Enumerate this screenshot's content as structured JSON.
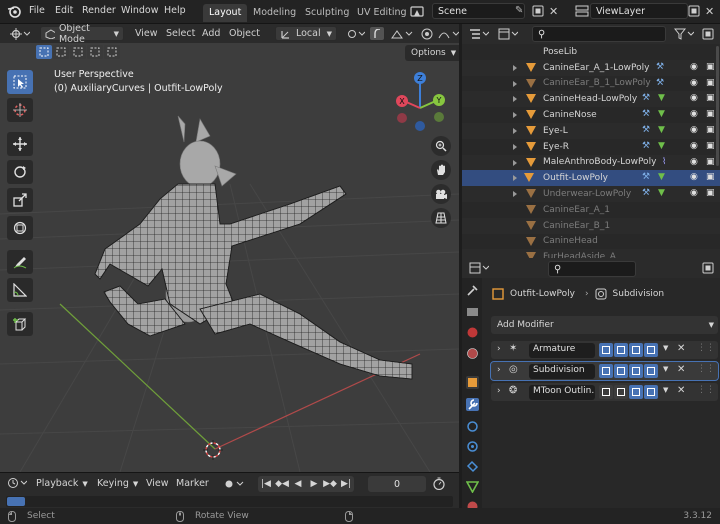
{
  "menubar": {
    "items": [
      "File",
      "Edit",
      "Render",
      "Window",
      "Help"
    ]
  },
  "workspaces": [
    "Layout",
    "Modeling",
    "Sculpting",
    "UV Editing"
  ],
  "scene": {
    "name": "Scene"
  },
  "view_layer": {
    "name": "ViewLayer"
  },
  "viewport": {
    "mode": "Object Mode",
    "menus": [
      "View",
      "Select",
      "Add",
      "Object"
    ],
    "transform_orientation": "Local",
    "options_label": "Options",
    "overlay_title": "User Perspective",
    "overlay_subtitle": "(0) AuxiliaryCurves | Outfit-LowPoly",
    "gizmo_axes": {
      "z": "Z",
      "y": "Y",
      "x": "X"
    }
  },
  "timeline": {
    "playback": "Playback",
    "keying": "Keying",
    "view": "View",
    "marker": "Marker",
    "current_frame": "0"
  },
  "status": {
    "select": "Select",
    "rotate_view": "Rotate View",
    "version": "3.3.12"
  },
  "outliner": {
    "rows": [
      {
        "name": "PoseLib"
      },
      {
        "name": "CanineEar_A_1-LowPoly"
      },
      {
        "name": "CanineEar_B_1_LowPoly"
      },
      {
        "name": "CanineHead-LowPoly"
      },
      {
        "name": "CanineNose"
      },
      {
        "name": "Eye-L"
      },
      {
        "name": "Eye-R"
      },
      {
        "name": "MaleAnthroBody-LowPoly"
      },
      {
        "name": "Outfit-LowPoly"
      },
      {
        "name": "Underwear-LowPoly"
      },
      {
        "name": "CanineEar_A_1"
      },
      {
        "name": "CanineEar_B_1"
      },
      {
        "name": "CanineHead"
      },
      {
        "name": "FurHeadAside_A"
      }
    ]
  },
  "properties": {
    "object_name": "Outfit-LowPoly",
    "modifier_context": "Subdivision",
    "add_modifier": "Add Modifier",
    "modifiers": [
      {
        "name": "Armature"
      },
      {
        "name": "Subdivision"
      },
      {
        "name": "MToon Outlin..."
      }
    ]
  },
  "colors": {
    "accent": "#4772b3",
    "object_orange": "#e69b3a",
    "selected_row": "#334d80",
    "x_axis": "#e0475b",
    "y_axis": "#87c63f",
    "z_axis": "#3d7fd9"
  }
}
